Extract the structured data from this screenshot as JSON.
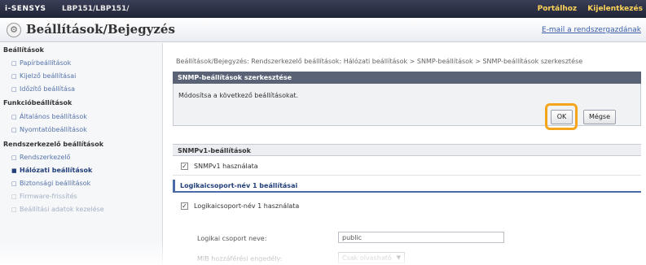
{
  "topbar": {
    "brand": "i-SENSYS",
    "model": "LBP151/LBP151/",
    "link_portal": "Portálhoz",
    "link_logout": "Kijelentkezés"
  },
  "titlebar": {
    "title": "Beállítások/Bejegyzés",
    "mail_link": "E-mail a rendszergazdának",
    "icon": "settings-icon"
  },
  "sidebar": {
    "section1": "Beállítások",
    "items1": [
      "Papírbeállítások",
      "Kijelző beállításai",
      "Időzítő beállítása"
    ],
    "section2": "Funkcióbeállítások",
    "items2": [
      "Általános beállítások",
      "Nyomtatóbeállítások"
    ],
    "section3": "Rendszerkezelő beállítások",
    "items3": [
      "Rendszerkezelő",
      "Hálózati beállítások",
      "Biztonsági beállítások",
      "Firmware-frissítés",
      "Beállítási adatok kezelése"
    ]
  },
  "main": {
    "breadcrumb": "Beállítások/Bejegyzés: Rendszerkezelő beállítások: Hálózati beállítások > SNMP-beállítások > SNMP-beállítások szerkesztése",
    "panel_title": "SNMP-beállítások szerkesztése",
    "panel_message": "Módosítsa a következő beállításokat.",
    "ok_label": "OK",
    "cancel_label": "Mégse",
    "snmpv1_section": "SNMPv1-beállítások",
    "snmpv1_use": "SNMPv1 használata",
    "community_section": "Logikaicsoport-név 1 beállításai",
    "community_use": "Logikaicsoport-név 1 használata",
    "community_name_label": "Logikai csoport neve:",
    "community_name_value": "public",
    "mib_access_label": "MIB hozzáférési engedély:",
    "mib_access_value": "Csak olvasható"
  },
  "colors": {
    "highlight": "#f5a51b",
    "panel_header": "#5a6276",
    "section_accent": "#4a6ba8"
  }
}
